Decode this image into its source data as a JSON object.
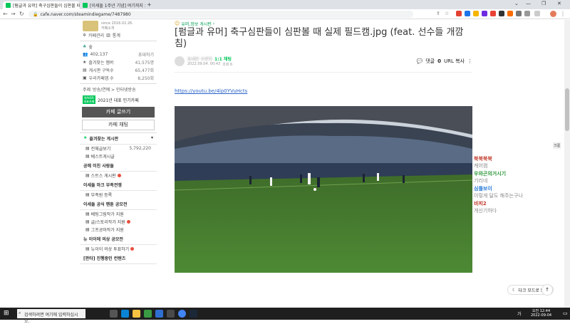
{
  "browser": {
    "tabs": [
      {
        "label": "[펌글과 유머] 축구심판들이 심판볼 때 실..."
      },
      {
        "label": "[이세돌 1주년 기념] 여기까지 오..."
      }
    ],
    "url": "cafe.naver.com/steamindiegame/7487980",
    "ext_colors": [
      "#e34133",
      "#1a73e8",
      "#f6b402",
      "#6d2ae0",
      "#e94235",
      "#333333",
      "#ff6d00"
    ]
  },
  "cafe_sidebar": {
    "since_text": "since 2016.02.26.",
    "cafe_intro_link": "카페소개",
    "admin_link": "카페관리",
    "stats_link": "통계",
    "level": "숲",
    "members_count": "402,137",
    "invite_link": "초대하기",
    "fav_label": "즐겨찾는 멤버",
    "fav_value": "41,575명",
    "sub_label": "게시판 구독수",
    "sub_value": "65,477회",
    "reply_label": "우리카페앱 수",
    "reply_value": "8,250회",
    "tags_label": "주제",
    "tags_value": "방송/연예 > 인터넷방송",
    "badge_text": "NAVER 대표카페",
    "badge_title": "2021년 대표 인기카페",
    "write_button": "카페 글쓰기",
    "chat_button": "카페 채팅",
    "fav_board_header": "즐겨찾는 게시판",
    "all_posts": "전체글보기",
    "all_posts_count": "5,792,220",
    "best_posts": "베스트게시글",
    "sec1": "공헤 미친 사람들",
    "sec1_item1": "스트스 게시판",
    "sec2": "이세돌 마크 부족전쟁",
    "sec2_item1": "부족원 등록",
    "sec3": "이세돌 공식 팬툰 공모전",
    "sec3_item1": "베팅그림작가 지원",
    "sec3_item2": "글/스토리작가 지원",
    "sec3_item3": "그프공마작가 지원",
    "sec4": "뉴 이이에 의상 공모전",
    "sec4_item1": "뉴이이 의상 투표하기",
    "sec5": "[판타] 진행중인 컨텐츠"
  },
  "article": {
    "board_link": "유머,정보 게시판",
    "title": "[펌글과 유머] 축구심판들이 심판볼 때 실제 필드캠.jpg (feat. 선수들 개깜침)",
    "title_suffix_chevron": "⌄",
    "author": "동네만 수련자",
    "chat_tag": "1:1 채팅",
    "date": "2022.09.04. 00:43",
    "views": "조회 6",
    "comments_label": "댓글",
    "comments_count": "0",
    "url_copy": "URL 복사",
    "link": "https://youtu.be/4lp0YVuHcts"
  },
  "chat": {
    "messages": [
      {
        "name": "북북북북",
        "text": "캐어캠",
        "color": "#c0392b"
      },
      {
        "name": "우와곤의거시기",
        "text": "기리네",
        "color": "#2e9a3b"
      },
      {
        "name": "심플보이",
        "text": "이렇게 달도 해주는구나",
        "color": "#2a7bd6"
      },
      {
        "name": "비피2",
        "text": "개신기하다",
        "color": "#c0392b"
      }
    ],
    "dark_mode_label": "다크 모드로 보기",
    "scroll_top": "↑"
  },
  "taskbar": {
    "search_placeholder": "검색하려면 여기에 입력하십시오.",
    "time": "오전 12:44",
    "date": "2022-09-04",
    "lang": "가"
  },
  "side_label": "크롬"
}
